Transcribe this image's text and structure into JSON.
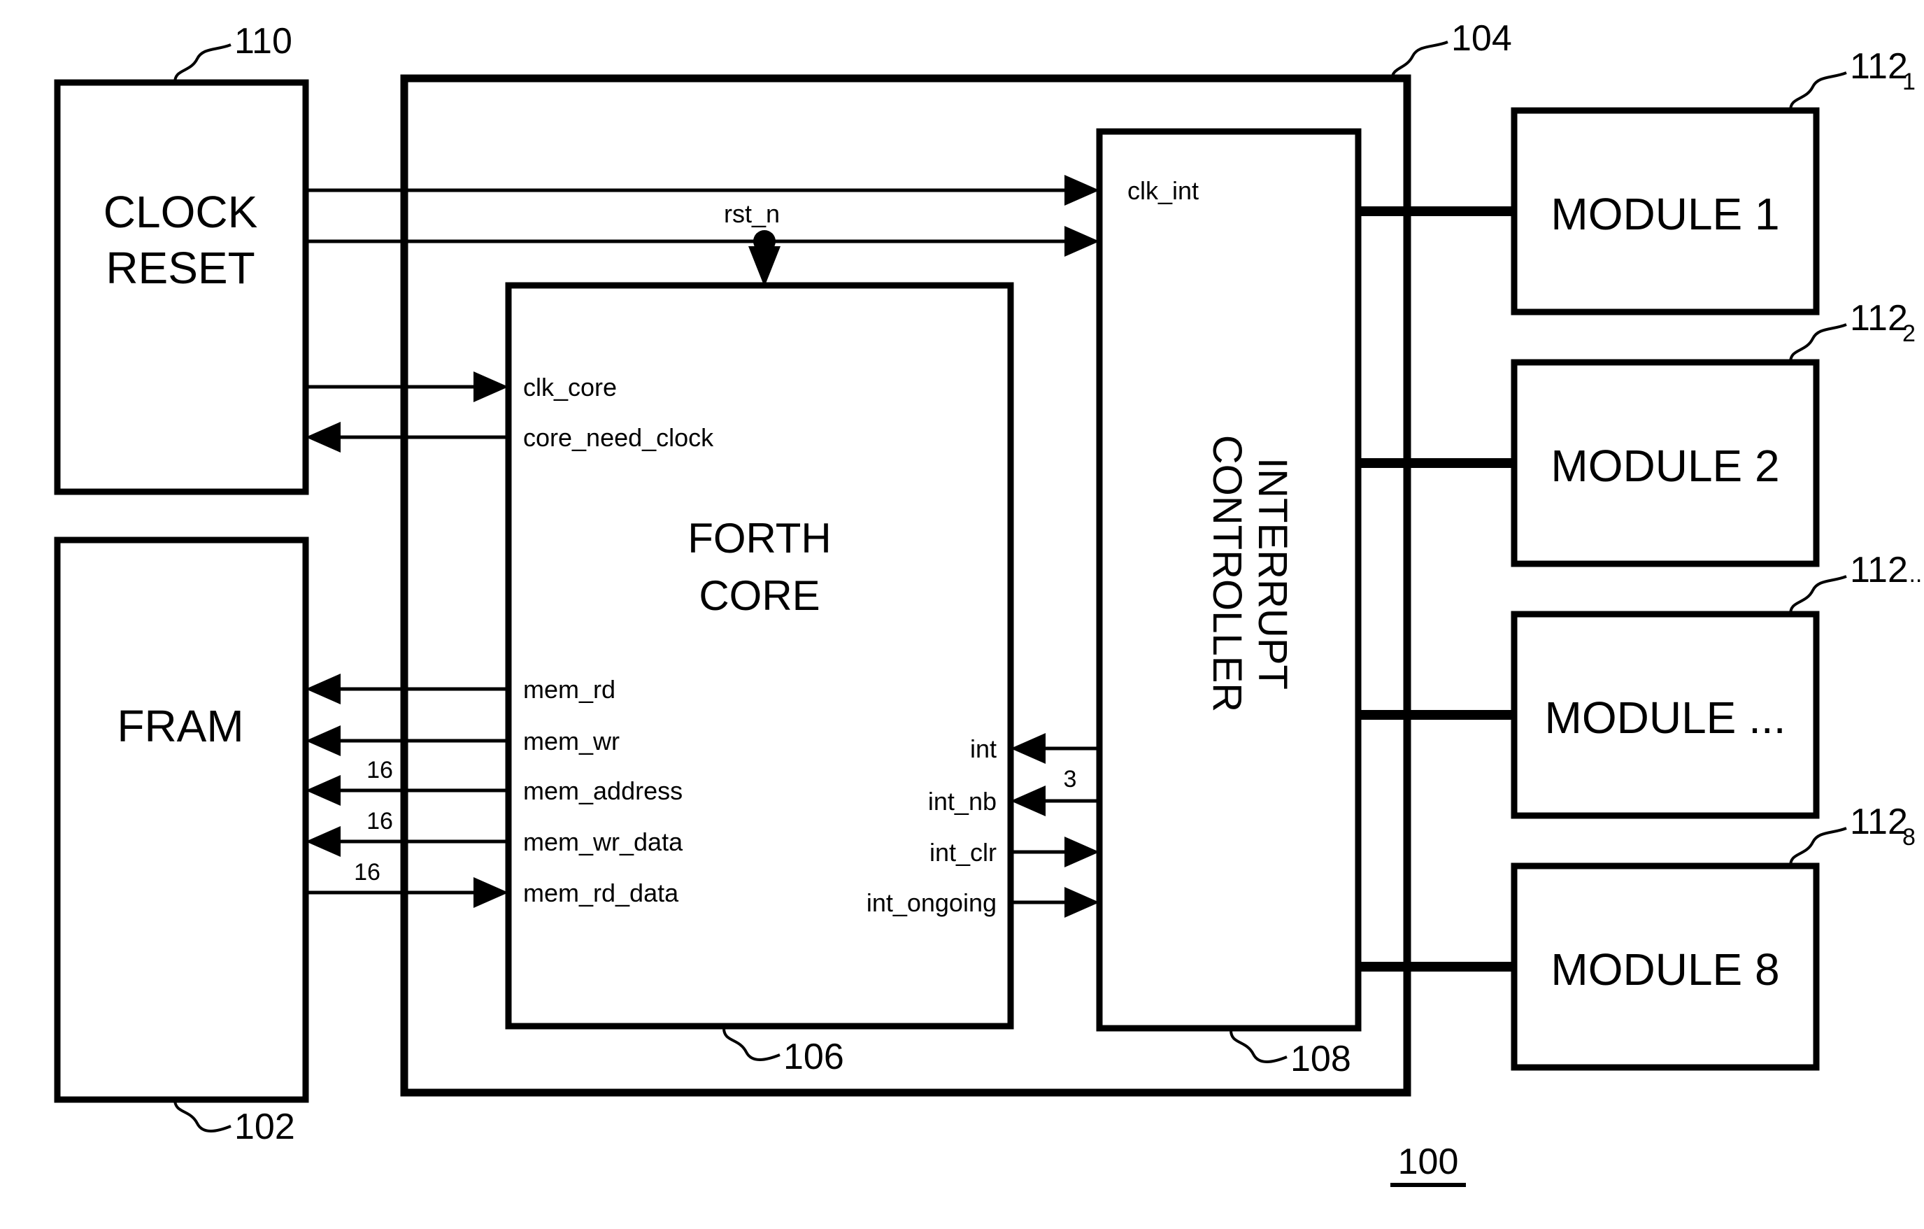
{
  "figure": {
    "number": "100",
    "type": "patent-block-diagram"
  },
  "blocks": {
    "clock_reset": {
      "line1": "CLOCK",
      "line2": "RESET",
      "ref": "110"
    },
    "fram": {
      "label": "FRAM",
      "ref": "102"
    },
    "forth_core": {
      "line1": "FORTH",
      "line2": "CORE",
      "ref": "106"
    },
    "interrupt_controller": {
      "line1": "INTERRUPT",
      "line2": "CONTROLLER",
      "ref": "108",
      "clk_label": "clk_int"
    },
    "system_on_chip": {
      "ref": "104"
    }
  },
  "modules": [
    {
      "label": "MODULE 1",
      "ref": "112",
      "sub": "1"
    },
    {
      "label": "MODULE 2",
      "ref": "112",
      "sub": "2"
    },
    {
      "label": "MODULE ...",
      "ref": "112",
      "sub": "..."
    },
    {
      "label": "MODULE 8",
      "ref": "112",
      "sub": "8"
    }
  ],
  "signals": {
    "rst_n": "rst_n",
    "clk_core": "clk_core",
    "core_need_clock": "core_need_clock",
    "mem_rd": "mem_rd",
    "mem_wr": "mem_wr",
    "mem_address": "mem_address",
    "mem_wr_data": "mem_wr_data",
    "mem_rd_data": "mem_rd_data",
    "int": "int",
    "int_nb": "int_nb",
    "int_clr": "int_clr",
    "int_ongoing": "int_ongoing"
  },
  "bus_widths": {
    "mem_address": "16",
    "mem_wr_data": "16",
    "mem_rd_data": "16",
    "int_nb": "3"
  },
  "colors": {
    "line": "#000000",
    "background": "#ffffff",
    "text": "#000000"
  }
}
